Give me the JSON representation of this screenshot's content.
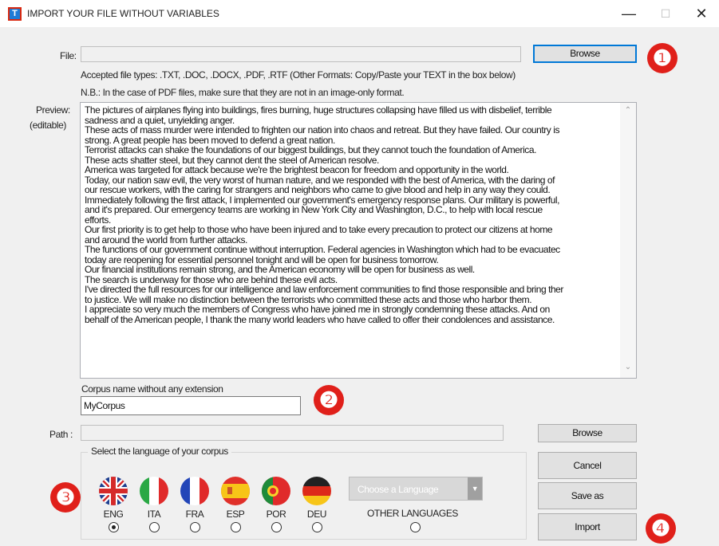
{
  "window": {
    "title": "IMPORT YOUR FILE WITHOUT VARIABLES",
    "icon_letter": "T",
    "controls": {
      "minimize": "—",
      "maximize": "☐",
      "close": "✕"
    }
  },
  "file": {
    "label": "File:",
    "value": "",
    "browse_label": "Browse",
    "accepted_text": "Accepted file types: .TXT, .DOC, .DOCX, .PDF, .RTF (Other Formats: Copy/Paste your TEXT in the box below)",
    "note_text": "N.B.: In the case of PDF files, make sure that they are not in an image-only format."
  },
  "preview": {
    "label_1": "Preview:",
    "label_2": "(editable)",
    "text": "The pictures of airplanes flying into buildings, fires burning, huge structures collapsing have filled us with disbelief, terrible\nsadness and a quiet, unyielding anger.\nThese acts of mass murder were intended to frighten our nation into chaos and retreat. But they have failed. Our country is\nstrong. A great people has been moved to defend a great nation.\nTerrorist attacks can shake the foundations of our biggest buildings, but they cannot touch the foundation of America.\nThese acts shatter steel, but they cannot dent the steel of American resolve.\nAmerica was targeted for attack because we're the brightest beacon for freedom and opportunity in the world.\nToday, our nation saw evil, the very worst of human nature, and we responded with the best of America, with the daring of\nour rescue workers, with the caring for strangers and neighbors who came to give blood and help in any way they could.\nImmediately following the first attack, I implemented our government's emergency response plans. Our military is powerful,\nand it's prepared. Our emergency teams are working in New York City and Washington, D.C., to help with local rescue\nefforts.\nOur first priority is to get help to those who have been injured and to take every precaution to protect our citizens at home\nand around the world from further attacks.\nThe functions of our government continue without interruption. Federal agencies in Washington which had to be evacuatec\ntoday are reopening for essential personnel tonight and will be open for business tomorrow.\nOur financial institutions remain strong, and the American economy will be open for business as well.\nThe search is underway for those who are behind these evil acts.\nI've directed the full resources for our intelligence and law enforcement communities to find those responsible and bring ther\nto justice. We will make no distinction between the terrorists who committed these acts and those who harbor them.\nI appreciate so very much the members of Congress who have joined me in strongly condemning these attacks. And on\nbehalf of the American people, I thank the many world leaders who have called to offer their condolences and assistance."
  },
  "corpus": {
    "label": "Corpus name without any extension",
    "value": "MyCorpus"
  },
  "path": {
    "label": "Path :",
    "value": "",
    "browse_label": "Browse"
  },
  "language": {
    "group_label": "Select the language of your corpus",
    "flags": [
      {
        "code": "ENG",
        "icon": "uk-flag-icon",
        "selected": true
      },
      {
        "code": "ITA",
        "icon": "italy-flag-icon",
        "selected": false
      },
      {
        "code": "FRA",
        "icon": "france-flag-icon",
        "selected": false
      },
      {
        "code": "ESP",
        "icon": "spain-flag-icon",
        "selected": false
      },
      {
        "code": "POR",
        "icon": "portugal-flag-icon",
        "selected": false
      },
      {
        "code": "DEU",
        "icon": "germany-flag-icon",
        "selected": false
      }
    ],
    "combo_placeholder": "Choose a Language",
    "other_label": "OTHER LANGUAGES"
  },
  "actions": {
    "cancel_label": "Cancel",
    "save_as_label": "Save as",
    "import_label": "Import"
  },
  "badges": [
    "❶",
    "❷",
    "❸",
    "❹"
  ],
  "colors": {
    "badge": "#e0201a",
    "focus": "#0078d7"
  }
}
